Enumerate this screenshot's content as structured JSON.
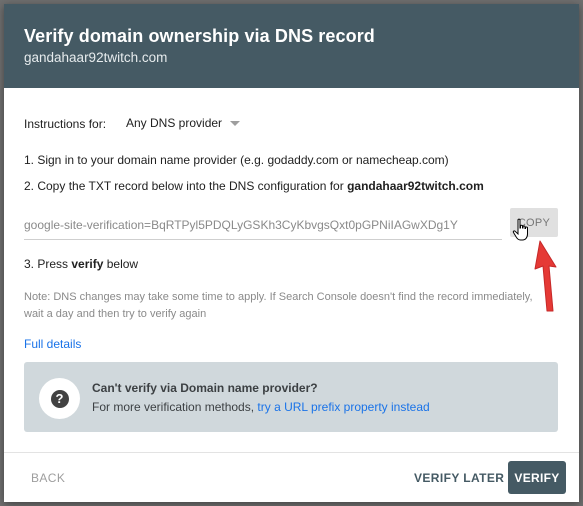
{
  "dialog": {
    "title": "Verify domain ownership via DNS record",
    "subtitle": "gandahaar92twitch.com"
  },
  "instructions": {
    "label": "Instructions for:",
    "provider_value": "Any DNS provider"
  },
  "steps": {
    "step1": "1. Sign in to your domain name provider (e.g. godaddy.com or namecheap.com)",
    "step2_prefix": "2. Copy the TXT record below into the DNS configuration for ",
    "step2_domain": "gandahaar92twitch.com",
    "step3_prefix": "3. Press ",
    "step3_bold": "verify",
    "step3_suffix": " below"
  },
  "txt_record": {
    "value": "google-site-verification=BqRTPyl5PDQLyGSKh3CyKbvgsQxt0pGPNiIAGwXDg1Y",
    "copy_label": "COPY"
  },
  "note": "Note: DNS changes may take some time to apply. If Search Console doesn't find the record immediately, wait a day and then try to verify again",
  "full_details": "Full details",
  "alt_box": {
    "title": "Can't verify via Domain name provider?",
    "text": "For more verification methods, ",
    "link": "try a URL prefix property instead"
  },
  "footer": {
    "back": "BACK",
    "verify_later": "VERIFY LATER",
    "verify": "VERIFY"
  },
  "icons": {
    "caret": "dropdown-caret-icon",
    "help": "question-icon",
    "cursor": "hand-pointer-icon",
    "arrow": "red-up-arrow-icon"
  },
  "colors": {
    "header": "#455a64",
    "link": "#1a73e8",
    "annotation_arrow": "#e53935",
    "info_box": "#d0d8dc"
  }
}
